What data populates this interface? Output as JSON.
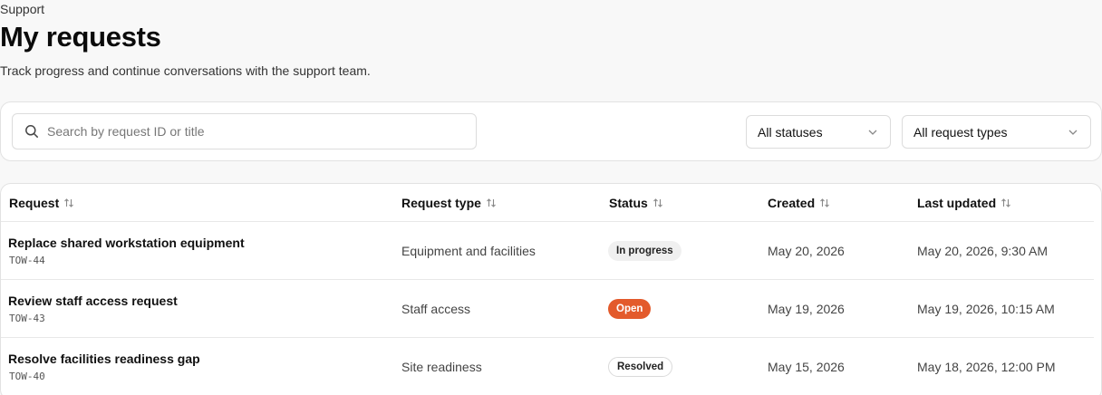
{
  "header": {
    "eyebrow": "Support",
    "title": "My requests",
    "subtitle": "Track progress and continue conversations with the support team."
  },
  "filters": {
    "search_placeholder": "Search by request ID or title",
    "search_value": "",
    "status_select": "All statuses",
    "type_select": "All request types"
  },
  "table": {
    "columns": [
      "Request",
      "Request type",
      "Status",
      "Created",
      "Last updated"
    ],
    "rows": [
      {
        "title": "Replace shared workstation equipment",
        "id": "TOW-44",
        "type": "Equipment and facilities",
        "status": "In progress",
        "created": "May 20, 2026",
        "updated": "May 20, 2026, 9:30 AM"
      },
      {
        "title": "Review staff access request",
        "id": "TOW-43",
        "type": "Staff access",
        "status": "Open",
        "created": "May 19, 2026",
        "updated": "May 19, 2026, 10:15 AM"
      },
      {
        "title": "Resolve facilities readiness gap",
        "id": "TOW-40",
        "type": "Site readiness",
        "status": "Resolved",
        "created": "May 15, 2026",
        "updated": "May 18, 2026, 12:00 PM"
      }
    ]
  },
  "colors": {
    "open_badge": "#e35a2b",
    "in_progress_badge": "#f0f0f0",
    "page_background": "#f8f8f8"
  },
  "icons": {
    "search": "search-icon",
    "dropdown": "chevron-down-icon",
    "sort": "sort-arrows-icon"
  }
}
